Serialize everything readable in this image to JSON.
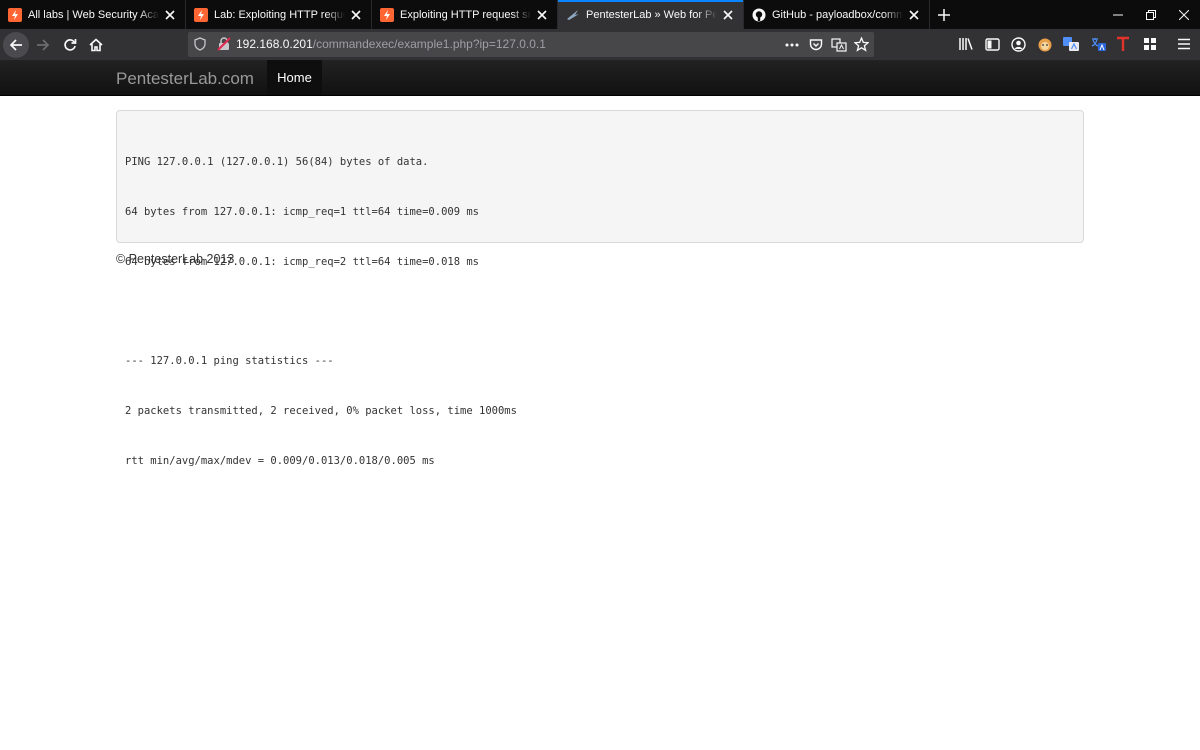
{
  "browser": {
    "tabs": [
      {
        "title": "All labs | Web Security Academy",
        "favicon": "portswigger-icon",
        "active": false
      },
      {
        "title": "Lab: Exploiting HTTP request smuggling",
        "favicon": "portswigger-icon",
        "active": false
      },
      {
        "title": "Exploiting HTTP request smuggling",
        "favicon": "portswigger-icon",
        "active": false
      },
      {
        "title": "PentesterLab » Web for Pentester",
        "favicon": "pentesterlab-icon",
        "active": true
      },
      {
        "title": "GitHub - payloadbox/command-injection",
        "favicon": "github-icon",
        "active": false
      }
    ],
    "url_host": "192.168.0.201",
    "url_path": "/commandexec/example1.php?ip=127.0.0.1",
    "extension_badge": "local",
    "accent_color": "#0a84ff"
  },
  "site": {
    "brand": "PentesterLab.com",
    "nav_home": "Home",
    "output_lines": [
      "PING 127.0.0.1 (127.0.0.1) 56(84) bytes of data.",
      "64 bytes from 127.0.0.1: icmp_req=1 ttl=64 time=0.009 ms",
      "64 bytes from 127.0.0.1: icmp_req=2 ttl=64 time=0.018 ms",
      "",
      "--- 127.0.0.1 ping statistics ---",
      "2 packets transmitted, 2 received, 0% packet loss, time 1000ms",
      "rtt min/avg/max/mdev = 0.009/0.013/0.018/0.005 ms"
    ],
    "footer": "© PentesterLab 2013"
  }
}
